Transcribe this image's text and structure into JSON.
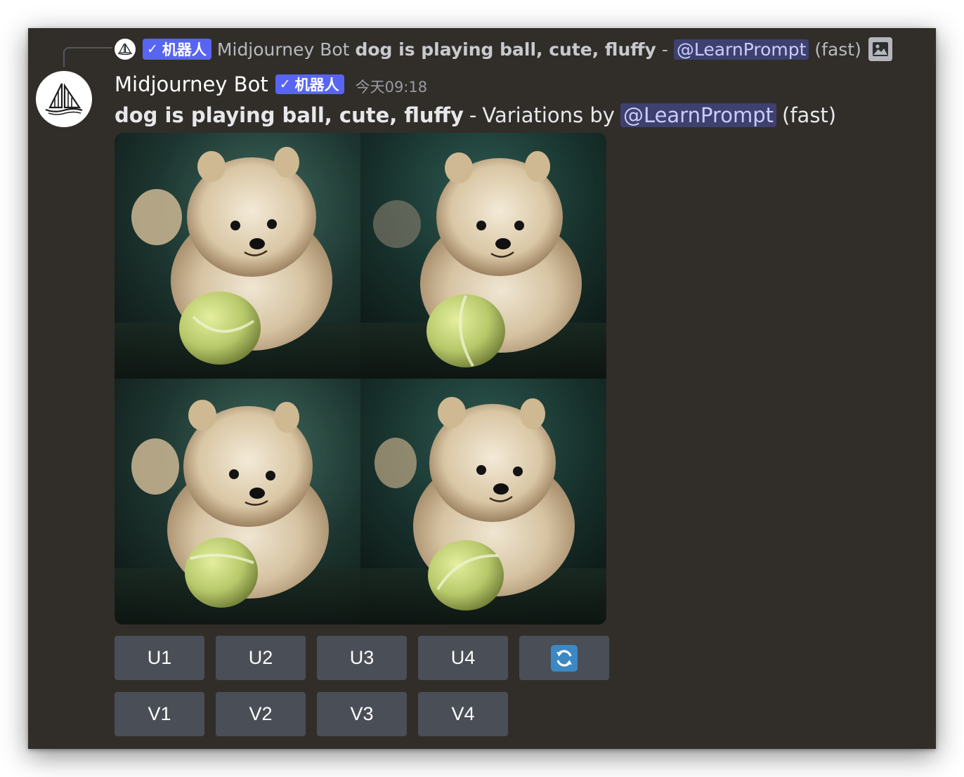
{
  "reply": {
    "badge_check": "✓",
    "badge_label": "机器人",
    "author": "Midjourney Bot",
    "prompt": "dog is playing ball, cute, fluffy",
    "separator": "-",
    "mention": "@LearnPrompt",
    "mode": "(fast)",
    "attachment_icon": "image-icon"
  },
  "message": {
    "author": "Midjourney Bot",
    "badge_check": "✓",
    "badge_label": "机器人",
    "timestamp": "今天09:18",
    "prompt": "dog is playing ball, cute, fluffy",
    "separator": "-",
    "variations_text": "Variations by",
    "mention": "@LearnPrompt",
    "mode": "(fast)",
    "avatar_icon": "sailboat-icon"
  },
  "image_grid": {
    "tiles": [
      "pomeranian-with-tennis-ball-1",
      "pomeranian-with-tennis-ball-2",
      "pomeranian-with-tennis-ball-3",
      "pomeranian-with-tennis-ball-4"
    ]
  },
  "buttons": {
    "upscale": [
      "U1",
      "U2",
      "U3",
      "U4"
    ],
    "variation": [
      "V1",
      "V2",
      "V3",
      "V4"
    ],
    "reroll_icon": "refresh-icon"
  },
  "colors": {
    "background": "#312e2a",
    "badge": "#5865f2",
    "button": "#4a4e56",
    "mention_text": "#c9cdfb",
    "reroll": "#3b88c3"
  }
}
